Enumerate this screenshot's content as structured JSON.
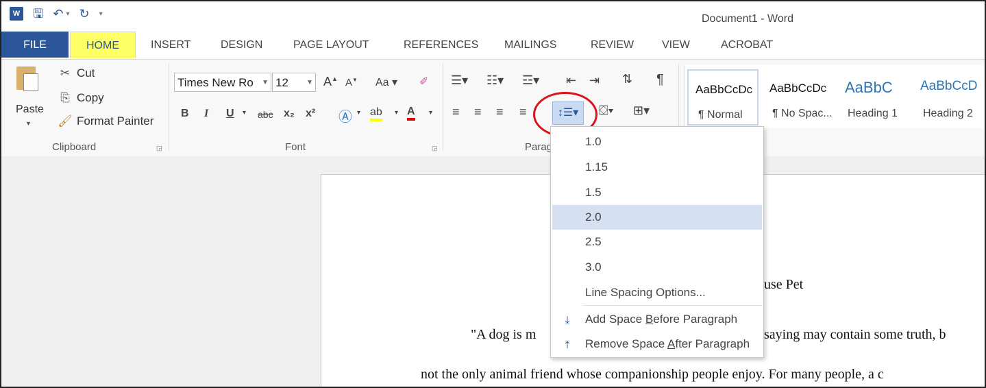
{
  "window": {
    "title": "Document1 - Word"
  },
  "qat": {
    "logo": "W",
    "save_icon": "save-icon",
    "undo_icon": "undo-icon",
    "redo_icon": "redo-icon"
  },
  "tabs": [
    {
      "label": "FILE"
    },
    {
      "label": "HOME"
    },
    {
      "label": "INSERT"
    },
    {
      "label": "DESIGN"
    },
    {
      "label": "PAGE LAYOUT"
    },
    {
      "label": "REFERENCES"
    },
    {
      "label": "MAILINGS"
    },
    {
      "label": "REVIEW"
    },
    {
      "label": "VIEW"
    },
    {
      "label": "ACROBAT"
    }
  ],
  "clipboard": {
    "paste": "Paste",
    "cut": "Cut",
    "copy": "Copy",
    "format_painter": "Format Painter",
    "group_label": "Clipboard"
  },
  "font": {
    "name": "Times New Ro",
    "size": "12",
    "group_label": "Font",
    "case": "Aa",
    "bold": "B",
    "italic": "I",
    "underline": "U",
    "strike": "abc",
    "subscript": "x₂",
    "superscript": "x²"
  },
  "paragraph": {
    "group_label": "Parag"
  },
  "styles": [
    {
      "preview": "AaBbCcDc",
      "name": "¶ Normal"
    },
    {
      "preview": "AaBbCcDc",
      "name": "¶ No Spac..."
    },
    {
      "preview": "AaBbC",
      "name": "Heading 1"
    },
    {
      "preview": "AaBbCcD",
      "name": "Heading 2"
    }
  ],
  "line_spacing_menu": {
    "options": [
      "1.0",
      "1.15",
      "1.5",
      "2.0",
      "2.5",
      "3.0"
    ],
    "selected": "2.0",
    "more": "Line Spacing Options...",
    "add_before_prefix": "Add Space ",
    "add_before_key": "B",
    "add_before_suffix": "efore Paragraph",
    "remove_after_prefix": "Remove Space ",
    "remove_after_key": "A",
    "remove_after_suffix": "fter Paragraph"
  },
  "document": {
    "title_fragment": "use Pet",
    "line1_start": "\"A dog is m",
    "line1_end": "saying may contain some truth, b",
    "line2": "not the only animal friend whose companionship people enjoy. For many people, a c"
  },
  "colors": {
    "accent": "#2b579a",
    "highlight_tab": "#ffff66",
    "circle": "#d9141b",
    "menu_highlight": "#d5e1f2"
  }
}
